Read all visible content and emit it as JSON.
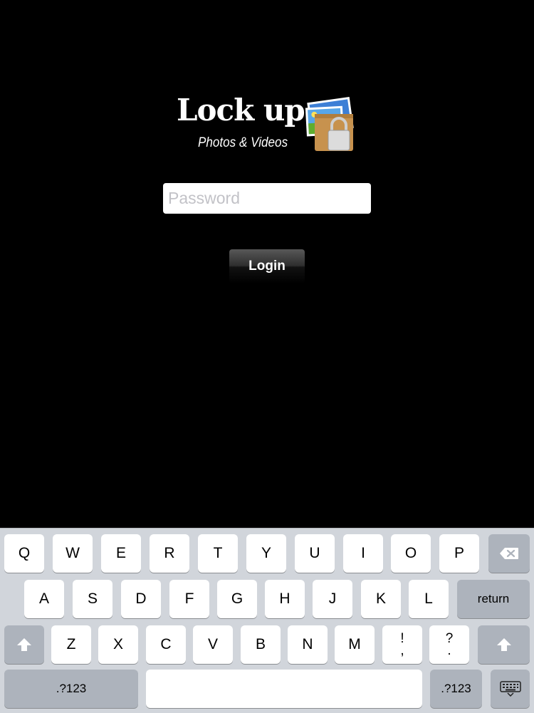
{
  "logo": {
    "title": "Lock up",
    "subtitle": "Photos & Videos",
    "icon": "photos-padlock-icon"
  },
  "password": {
    "placeholder": "Password",
    "value": ""
  },
  "login": {
    "label": "Login"
  },
  "keyboard": {
    "row1": [
      "Q",
      "W",
      "E",
      "R",
      "T",
      "Y",
      "U",
      "I",
      "O",
      "P"
    ],
    "row2": [
      "A",
      "S",
      "D",
      "F",
      "G",
      "H",
      "J",
      "K",
      "L"
    ],
    "row3": [
      "Z",
      "X",
      "C",
      "V",
      "B",
      "N",
      "M"
    ],
    "exclaim_top": "!",
    "exclaim_bottom": ",",
    "question_top": "?",
    "question_bottom": ".",
    "return_label": "return",
    "numbers_label": ".?123",
    "backspace_icon": "backspace-icon",
    "shift_icon": "shift-icon",
    "dismiss_icon": "keyboard-dismiss-icon"
  }
}
